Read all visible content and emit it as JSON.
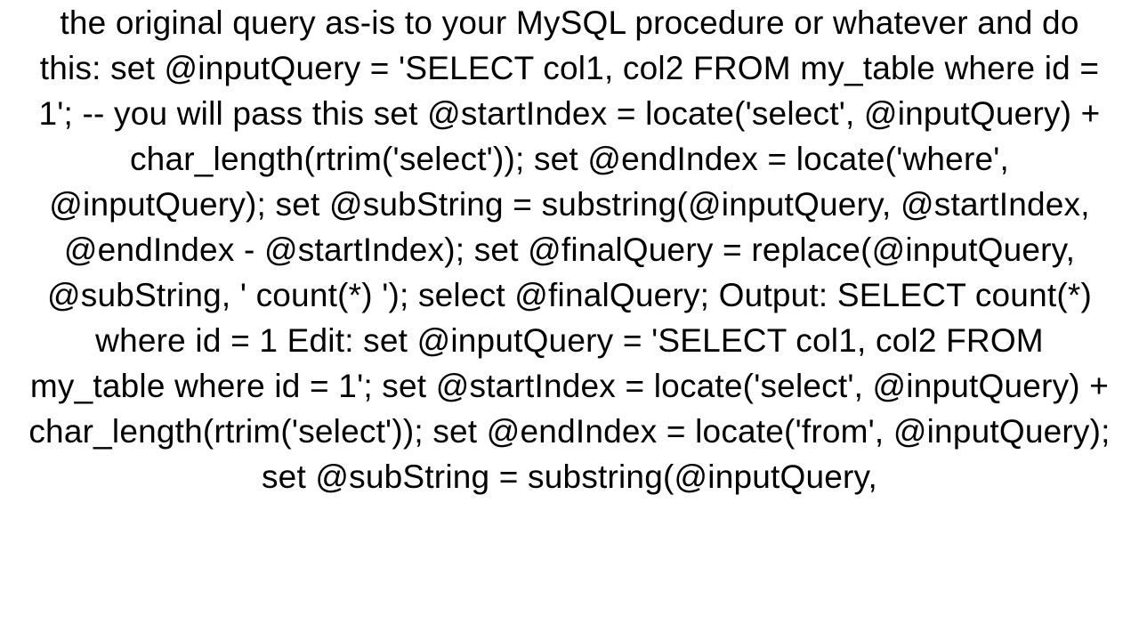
{
  "document": {
    "body_text": "the original query as-is to your MySQL procedure or whatever and do this: set @inputQuery = 'SELECT col1, col2 FROM my_table where id = 1'; -- you will pass this  set @startIndex = locate('select', @inputQuery) + char_length(rtrim('select')); set @endIndex = locate('where', @inputQuery); set @subString = substring(@inputQuery, @startIndex, @endIndex - @startIndex); set @finalQuery = replace(@inputQuery, @subString, ' count(*) ');  select @finalQuery;  Output: SELECT count(*) where id = 1  Edit: set @inputQuery = 'SELECT col1, col2 FROM my_table where id = 1';  set @startIndex = locate('select', @inputQuery) + char_length(rtrim('select')); set @endIndex = locate('from', @inputQuery); set @subString = substring(@inputQuery,"
  }
}
